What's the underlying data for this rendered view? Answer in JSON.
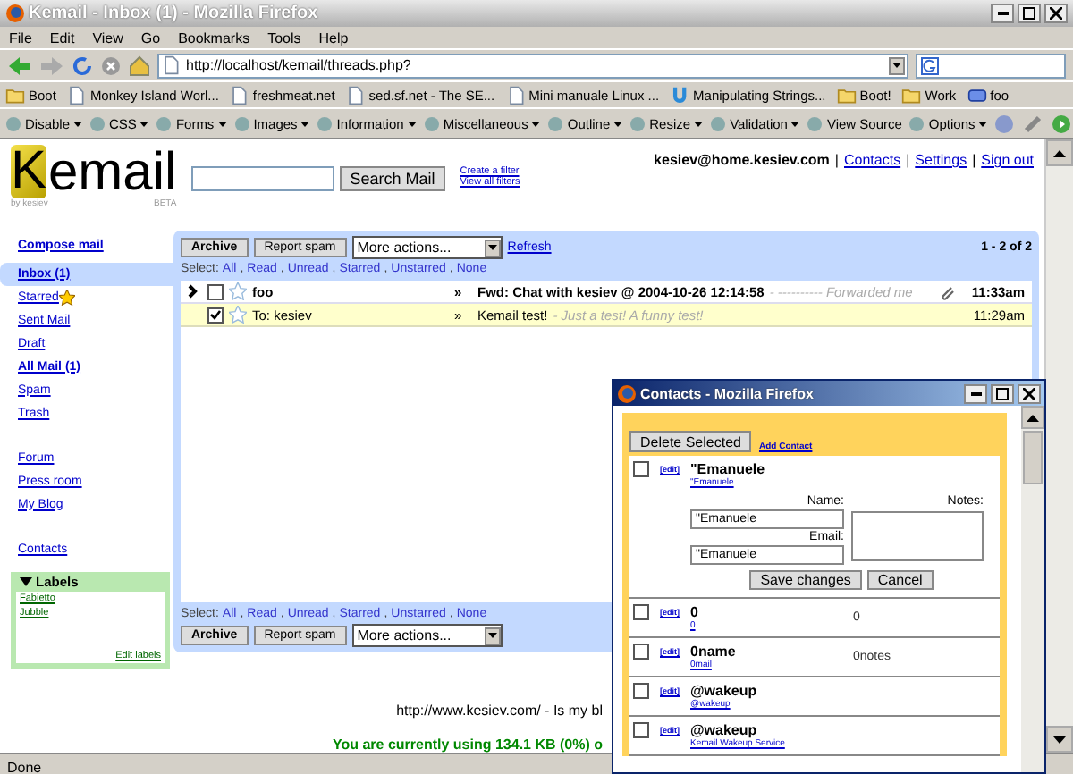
{
  "window": {
    "title": "Kemail - Inbox (1) - Mozilla Firefox"
  },
  "menu": [
    "File",
    "Edit",
    "View",
    "Go",
    "Bookmarks",
    "Tools",
    "Help"
  ],
  "nav": {
    "url": "http://localhost/kemail/threads.php?"
  },
  "bookmarks": [
    {
      "label": "Boot",
      "kind": "folder"
    },
    {
      "label": "Monkey Island Worl...",
      "kind": "page"
    },
    {
      "label": "freshmeat.net",
      "kind": "page"
    },
    {
      "label": "sed.sf.net - The SE...",
      "kind": "page"
    },
    {
      "label": "Mini manuale Linux ...",
      "kind": "page"
    },
    {
      "label": "Manipulating Strings...",
      "kind": "site"
    },
    {
      "label": "Boot!",
      "kind": "folder"
    },
    {
      "label": "Work",
      "kind": "folder"
    },
    {
      "label": "foo",
      "kind": "feed"
    }
  ],
  "devbar": [
    {
      "label": "Disable",
      "menu": true
    },
    {
      "label": "CSS",
      "menu": true
    },
    {
      "label": "Forms",
      "menu": true
    },
    {
      "label": "Images",
      "menu": true
    },
    {
      "label": "Information",
      "menu": true
    },
    {
      "label": "Miscellaneous",
      "menu": true
    },
    {
      "label": "Outline",
      "menu": true
    },
    {
      "label": "Resize",
      "menu": true
    },
    {
      "label": "Validation",
      "menu": true
    },
    {
      "label": "View Source",
      "menu": false
    },
    {
      "label": "Options",
      "menu": true
    }
  ],
  "header": {
    "logo_letter": "K",
    "logo_text": "email",
    "byline": "by kesiev",
    "badge": "BETA",
    "search_button": "Search Mail",
    "filter_links": [
      "Create a filter",
      "View all filters"
    ],
    "user": "kesiev@home.kesiev.com",
    "links": [
      {
        "separator": "|",
        "label": "Contacts"
      },
      {
        "separator": "|",
        "label": "Settings"
      },
      {
        "separator": "|",
        "label": "Sign out"
      }
    ]
  },
  "sidebar": {
    "compose": "Compose mail",
    "items": [
      {
        "label": "Inbox (1)",
        "selected": true,
        "bold": true,
        "starred": false
      },
      {
        "label": "Starred",
        "selected": false,
        "bold": false,
        "starred": true
      },
      {
        "label": "Sent Mail",
        "selected": false,
        "bold": false,
        "starred": false
      },
      {
        "label": "Draft",
        "selected": false,
        "bold": false,
        "starred": false
      },
      {
        "label": "All Mail (1)",
        "selected": false,
        "bold": true,
        "starred": false
      },
      {
        "label": "Spam",
        "selected": false,
        "bold": false,
        "starred": false
      },
      {
        "label": "Trash",
        "selected": false,
        "bold": false,
        "starred": false
      }
    ],
    "extra_links": [
      "Forum",
      "Press room",
      "My Blog"
    ],
    "contacts": "Contacts",
    "labels": {
      "title": "Labels",
      "items": [
        "Fabietto",
        "Jubble"
      ],
      "edit": "Edit labels"
    }
  },
  "toolbar_top": {
    "archive": "Archive",
    "report_spam": "Report spam",
    "more_actions": "More actions...",
    "refresh": "Refresh",
    "count": "1 - 2 of 2"
  },
  "select_top": {
    "label": "Select:",
    "options": [
      {
        "label": "All",
        "separator": ","
      },
      {
        "label": "Read",
        "separator": ","
      },
      {
        "label": "Unread",
        "separator": ","
      },
      {
        "label": "Starred",
        "separator": ","
      },
      {
        "label": "Unstarred",
        "separator": ","
      },
      {
        "label": "None"
      }
    ]
  },
  "threads": [
    {
      "flagged": true,
      "checked": false,
      "starred": false,
      "selected": false,
      "unread": true,
      "sender": "foo",
      "arrow": "»",
      "subject": "Fwd: Chat with kesiev @ 2004-10-26 12:14:58",
      "snippet": "- ---------- Forwarded me",
      "attachment": true,
      "time": "11:33am"
    },
    {
      "flagged": false,
      "checked": true,
      "starred": false,
      "selected": true,
      "unread": false,
      "sender": "To: kesiev",
      "arrow": "»",
      "subject": "Kemail test!",
      "snippet": "- Just a test! A funny test!",
      "attachment": false,
      "time": "11:29am"
    }
  ],
  "select_bottom": {
    "label": "Select:",
    "options": [
      {
        "label": "All",
        "separator": ","
      },
      {
        "label": "Read",
        "separator": ","
      },
      {
        "label": "Unread",
        "separator": ","
      },
      {
        "label": "Starred",
        "separator": ","
      },
      {
        "label": "Unstarred",
        "separator": ","
      },
      {
        "label": "None"
      }
    ]
  },
  "toolbar_bottom": {
    "archive": "Archive",
    "report_spam": "Report spam",
    "more_actions": "More actions..."
  },
  "footer": {
    "line_1": "http://www.kesiev.com/ - Is my bl",
    "line_2": "You are currently using 134.1 KB (0%) o"
  },
  "status_bar": "Done",
  "popup": {
    "title": "Contacts - Mozilla Firefox",
    "delete": "Delete Selected",
    "add": "Add Contact",
    "contacts": [
      {
        "edit": "[edit]",
        "name": "\"Emanuele",
        "email": "\"Emanuele",
        "checked": false,
        "expanded": true
      },
      {
        "edit": "[edit]",
        "name": "0",
        "email": "0",
        "notes": "0",
        "checked": false,
        "expanded": false
      },
      {
        "edit": "[edit]",
        "name": "0name",
        "email": "0mail",
        "notes": "0notes",
        "checked": false,
        "expanded": false
      },
      {
        "edit": "[edit]",
        "name": "@wakeup",
        "email": "@wakeup",
        "checked": false,
        "expanded": false
      },
      {
        "edit": "[edit]",
        "name": "@wakeup",
        "email": "Kemail Wakeup Service",
        "checked": false,
        "expanded": false
      }
    ],
    "form": {
      "name_label": "Name:",
      "email_label": "Email:",
      "notes_label": "Notes:",
      "name_value": "\"Emanuele",
      "email_value": "\"Emanuele",
      "save": "Save changes",
      "cancel": "Cancel"
    }
  }
}
